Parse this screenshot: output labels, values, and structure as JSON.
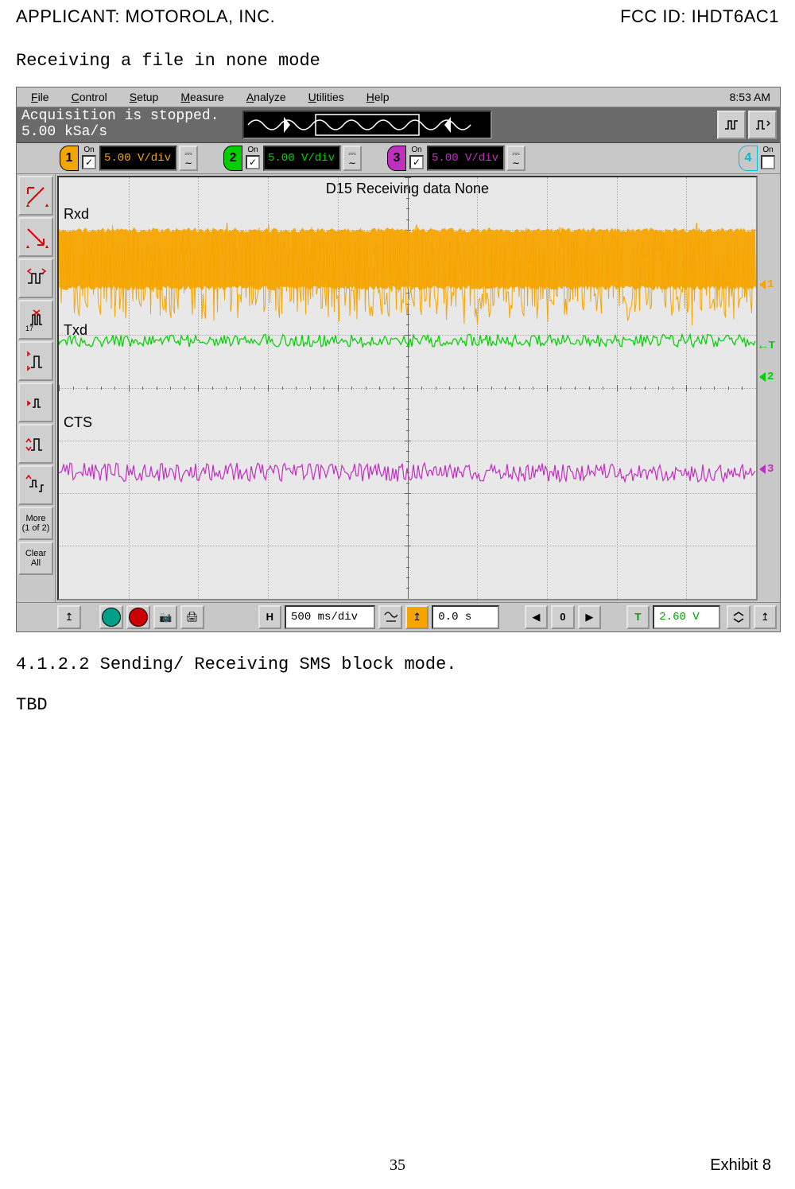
{
  "header": {
    "applicant_label": "APPLICANT:  MOTOROLA, INC.",
    "fcc_label": "FCC ID: IHDT6AC1"
  },
  "doc": {
    "caption": "Receiving a file in none mode",
    "section_heading": "4.1.2.2  Sending/ Receiving SMS block mode.",
    "tbd": "TBD"
  },
  "footer": {
    "page_number": "35",
    "exhibit": "Exhibit 8"
  },
  "scope": {
    "menubar": {
      "items": [
        "File",
        "Control",
        "Setup",
        "Measure",
        "Analyze",
        "Utilities",
        "Help"
      ],
      "clock": "8:53 AM"
    },
    "acquisition": {
      "line1": "Acquisition is stopped.",
      "line2": "5.00 kSa/s"
    },
    "channels": [
      {
        "num": "1",
        "on": true,
        "vdiv": "5.00 V/div",
        "color": "#f5a500"
      },
      {
        "num": "2",
        "on": true,
        "vdiv": "5.00 V/div",
        "color": "#00d000"
      },
      {
        "num": "3",
        "on": true,
        "vdiv": "5.00 V/div",
        "color": "#c030c0"
      },
      {
        "num": "4",
        "on": false,
        "vdiv": "",
        "color": "#00bcd4"
      }
    ],
    "chart_data": {
      "type": "line",
      "title": "D15 Receiving data None",
      "xlabel": "",
      "ylabel": "",
      "time_per_div": "500 ms/div",
      "delay": "0.0 s",
      "trigger_level": "2.60 V",
      "x_range_ms": [
        -2500,
        2500
      ],
      "vertical_divisions": 8,
      "signals": [
        {
          "name": "Rxd",
          "channel": 1,
          "color": "#f5a500",
          "baseline_div_from_top": 2.1,
          "amplitude_div": 1.1,
          "pattern": "dense-random",
          "label_y_div": 0.55
        },
        {
          "name": "Txd",
          "channel": 2,
          "color": "#00d000",
          "baseline_div_from_top": 3.1,
          "amplitude_div": 0.12,
          "pattern": "flat-noise",
          "label_y_div": 2.75
        },
        {
          "name": "CTS",
          "channel": 3,
          "color": "#c030c0",
          "baseline_div_from_top": 5.6,
          "amplitude_div": 0.18,
          "pattern": "flat-noise",
          "label_y_div": 4.5
        }
      ],
      "markers_right": [
        {
          "label": "1",
          "color": "#f5a500",
          "y_div": 2.1
        },
        {
          "label": "T",
          "color": "#00d000",
          "y_div": 3.25,
          "arrow": "left"
        },
        {
          "label": "2",
          "color": "#00d000",
          "y_div": 3.85
        },
        {
          "label": "3",
          "color": "#c030c0",
          "y_div": 5.6
        }
      ]
    },
    "left_tools": {
      "more_label": "More\n(1 of 2)",
      "clear_label": "Clear\nAll"
    },
    "bottom": {
      "h_label": "H",
      "time_div": "500 ms/div",
      "delay": "0.0 s",
      "trig_label": "T",
      "trig_level": "2.60 V"
    }
  }
}
